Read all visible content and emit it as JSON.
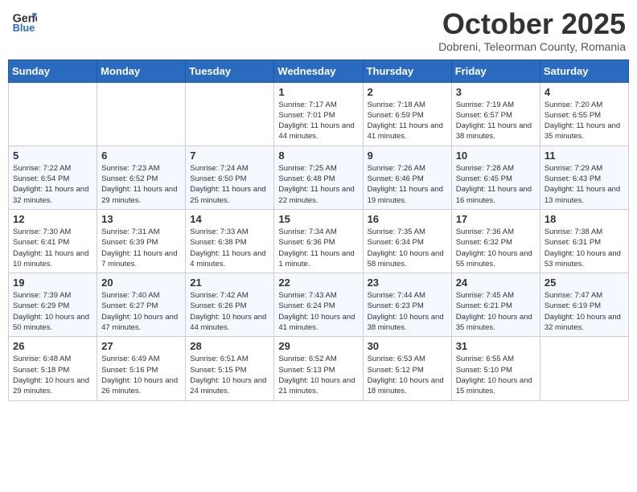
{
  "header": {
    "logo_general": "General",
    "logo_blue": "Blue",
    "month": "October 2025",
    "location": "Dobreni, Teleorman County, Romania"
  },
  "weekdays": [
    "Sunday",
    "Monday",
    "Tuesday",
    "Wednesday",
    "Thursday",
    "Friday",
    "Saturday"
  ],
  "weeks": [
    [
      {
        "day": "",
        "info": ""
      },
      {
        "day": "",
        "info": ""
      },
      {
        "day": "",
        "info": ""
      },
      {
        "day": "1",
        "info": "Sunrise: 7:17 AM\nSunset: 7:01 PM\nDaylight: 11 hours and 44 minutes."
      },
      {
        "day": "2",
        "info": "Sunrise: 7:18 AM\nSunset: 6:59 PM\nDaylight: 11 hours and 41 minutes."
      },
      {
        "day": "3",
        "info": "Sunrise: 7:19 AM\nSunset: 6:57 PM\nDaylight: 11 hours and 38 minutes."
      },
      {
        "day": "4",
        "info": "Sunrise: 7:20 AM\nSunset: 6:55 PM\nDaylight: 11 hours and 35 minutes."
      }
    ],
    [
      {
        "day": "5",
        "info": "Sunrise: 7:22 AM\nSunset: 6:54 PM\nDaylight: 11 hours and 32 minutes."
      },
      {
        "day": "6",
        "info": "Sunrise: 7:23 AM\nSunset: 6:52 PM\nDaylight: 11 hours and 29 minutes."
      },
      {
        "day": "7",
        "info": "Sunrise: 7:24 AM\nSunset: 6:50 PM\nDaylight: 11 hours and 25 minutes."
      },
      {
        "day": "8",
        "info": "Sunrise: 7:25 AM\nSunset: 6:48 PM\nDaylight: 11 hours and 22 minutes."
      },
      {
        "day": "9",
        "info": "Sunrise: 7:26 AM\nSunset: 6:46 PM\nDaylight: 11 hours and 19 minutes."
      },
      {
        "day": "10",
        "info": "Sunrise: 7:28 AM\nSunset: 6:45 PM\nDaylight: 11 hours and 16 minutes."
      },
      {
        "day": "11",
        "info": "Sunrise: 7:29 AM\nSunset: 6:43 PM\nDaylight: 11 hours and 13 minutes."
      }
    ],
    [
      {
        "day": "12",
        "info": "Sunrise: 7:30 AM\nSunset: 6:41 PM\nDaylight: 11 hours and 10 minutes."
      },
      {
        "day": "13",
        "info": "Sunrise: 7:31 AM\nSunset: 6:39 PM\nDaylight: 11 hours and 7 minutes."
      },
      {
        "day": "14",
        "info": "Sunrise: 7:33 AM\nSunset: 6:38 PM\nDaylight: 11 hours and 4 minutes."
      },
      {
        "day": "15",
        "info": "Sunrise: 7:34 AM\nSunset: 6:36 PM\nDaylight: 11 hours and 1 minute."
      },
      {
        "day": "16",
        "info": "Sunrise: 7:35 AM\nSunset: 6:34 PM\nDaylight: 10 hours and 58 minutes."
      },
      {
        "day": "17",
        "info": "Sunrise: 7:36 AM\nSunset: 6:32 PM\nDaylight: 10 hours and 55 minutes."
      },
      {
        "day": "18",
        "info": "Sunrise: 7:38 AM\nSunset: 6:31 PM\nDaylight: 10 hours and 53 minutes."
      }
    ],
    [
      {
        "day": "19",
        "info": "Sunrise: 7:39 AM\nSunset: 6:29 PM\nDaylight: 10 hours and 50 minutes."
      },
      {
        "day": "20",
        "info": "Sunrise: 7:40 AM\nSunset: 6:27 PM\nDaylight: 10 hours and 47 minutes."
      },
      {
        "day": "21",
        "info": "Sunrise: 7:42 AM\nSunset: 6:26 PM\nDaylight: 10 hours and 44 minutes."
      },
      {
        "day": "22",
        "info": "Sunrise: 7:43 AM\nSunset: 6:24 PM\nDaylight: 10 hours and 41 minutes."
      },
      {
        "day": "23",
        "info": "Sunrise: 7:44 AM\nSunset: 6:23 PM\nDaylight: 10 hours and 38 minutes."
      },
      {
        "day": "24",
        "info": "Sunrise: 7:45 AM\nSunset: 6:21 PM\nDaylight: 10 hours and 35 minutes."
      },
      {
        "day": "25",
        "info": "Sunrise: 7:47 AM\nSunset: 6:19 PM\nDaylight: 10 hours and 32 minutes."
      }
    ],
    [
      {
        "day": "26",
        "info": "Sunrise: 6:48 AM\nSunset: 5:18 PM\nDaylight: 10 hours and 29 minutes."
      },
      {
        "day": "27",
        "info": "Sunrise: 6:49 AM\nSunset: 5:16 PM\nDaylight: 10 hours and 26 minutes."
      },
      {
        "day": "28",
        "info": "Sunrise: 6:51 AM\nSunset: 5:15 PM\nDaylight: 10 hours and 24 minutes."
      },
      {
        "day": "29",
        "info": "Sunrise: 6:52 AM\nSunset: 5:13 PM\nDaylight: 10 hours and 21 minutes."
      },
      {
        "day": "30",
        "info": "Sunrise: 6:53 AM\nSunset: 5:12 PM\nDaylight: 10 hours and 18 minutes."
      },
      {
        "day": "31",
        "info": "Sunrise: 6:55 AM\nSunset: 5:10 PM\nDaylight: 10 hours and 15 minutes."
      },
      {
        "day": "",
        "info": ""
      }
    ]
  ]
}
